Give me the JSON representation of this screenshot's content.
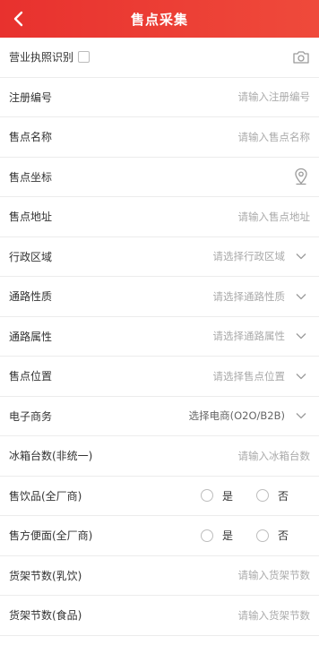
{
  "header": {
    "title": "售点采集",
    "back_icon": "chevron-left-icon",
    "background": "#e8312e"
  },
  "form": {
    "license": {
      "label": "营业执照识别",
      "icon": "camera-icon"
    },
    "reg_no": {
      "label": "注册编号",
      "placeholder": "请输入注册编号"
    },
    "store_name": {
      "label": "售点名称",
      "placeholder": "请输入售点名称"
    },
    "coords": {
      "label": "售点坐标",
      "icon": "location-pin-icon"
    },
    "address": {
      "label": "售点地址",
      "placeholder": "请输入售点地址"
    },
    "region": {
      "label": "行政区域",
      "placeholder": "请选择行政区域"
    },
    "channel_nature": {
      "label": "通路性质",
      "placeholder": "请选择通路性质"
    },
    "channel_attr": {
      "label": "通路属性",
      "placeholder": "请选择通路属性"
    },
    "store_position": {
      "label": "售点位置",
      "placeholder": "请选择售点位置"
    },
    "ecommerce": {
      "label": "电子商务",
      "placeholder": "选择电商(O2O/B2B)"
    },
    "fridge_count": {
      "label": "冰箱台数(非统一)",
      "placeholder": "请输入冰箱台数"
    },
    "sell_drinks": {
      "label": "售饮品(全厂商)",
      "yes": "是",
      "no": "否"
    },
    "sell_noodles": {
      "label": "售方便面(全厂商)",
      "yes": "是",
      "no": "否"
    },
    "shelf_dairy": {
      "label": "货架节数(乳饮)",
      "placeholder": "请输入货架节数"
    },
    "shelf_food": {
      "label": "货架节数(食品)",
      "placeholder": "请输入货架节数"
    }
  }
}
